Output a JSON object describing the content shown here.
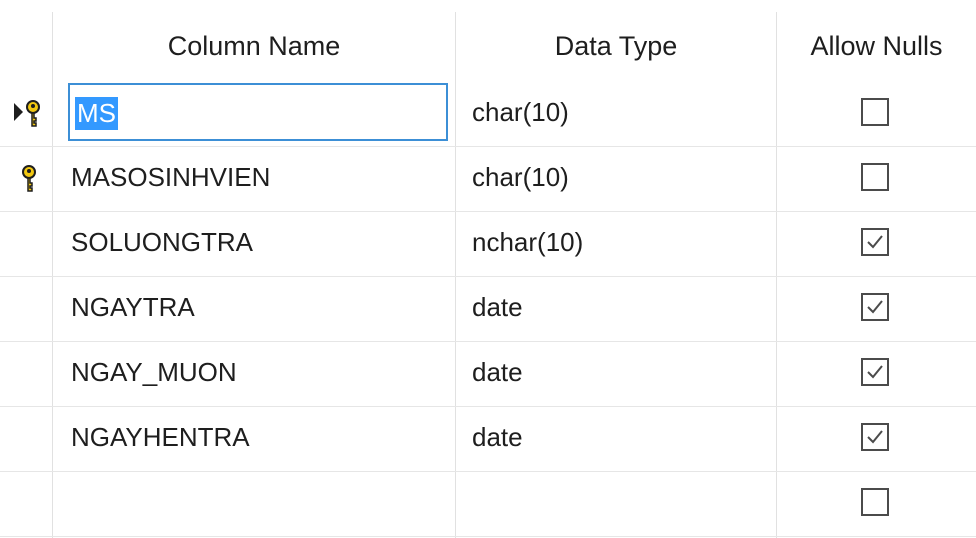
{
  "headers": {
    "column_name": "Column Name",
    "data_type": "Data Type",
    "allow_nulls": "Allow Nulls"
  },
  "rows": [
    {
      "name": "MS",
      "type": "char(10)",
      "allow_nulls": false,
      "primary_key": true,
      "current": true,
      "editing": true
    },
    {
      "name": "MASOSINHVIEN",
      "type": "char(10)",
      "allow_nulls": false,
      "primary_key": true,
      "current": false,
      "editing": false
    },
    {
      "name": "SOLUONGTRA",
      "type": "nchar(10)",
      "allow_nulls": true,
      "primary_key": false,
      "current": false,
      "editing": false
    },
    {
      "name": "NGAYTRA",
      "type": "date",
      "allow_nulls": true,
      "primary_key": false,
      "current": false,
      "editing": false
    },
    {
      "name": "NGAY_MUON",
      "type": "date",
      "allow_nulls": true,
      "primary_key": false,
      "current": false,
      "editing": false
    },
    {
      "name": "NGAYHENTRA",
      "type": "date",
      "allow_nulls": true,
      "primary_key": false,
      "current": false,
      "editing": false
    },
    {
      "name": "",
      "type": "",
      "allow_nulls": false,
      "primary_key": false,
      "current": false,
      "editing": false
    }
  ],
  "icons": {
    "primary_key": "key-icon",
    "row_pointer": "row-selector-arrow-icon",
    "checkbox_checked": "checkmark-icon"
  },
  "colors": {
    "selection": "#3399ff",
    "edit_border": "#3c8fd6",
    "key": "#f2c811",
    "grid_line": "#e1e1e1"
  }
}
